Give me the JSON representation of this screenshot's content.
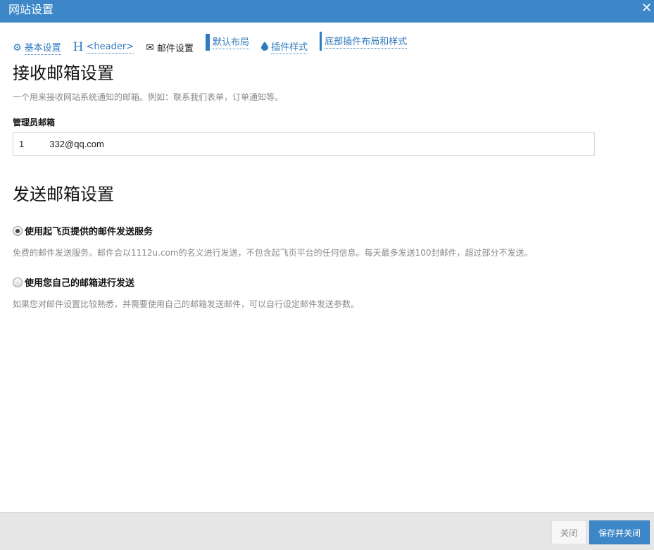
{
  "window": {
    "title": "网站设置",
    "close_label": "✕"
  },
  "tabs": [
    {
      "label": "基本设置",
      "icon": "gear-icon",
      "glyph": "⚙",
      "active": false
    },
    {
      "label": "<header>",
      "icon": "header-h-icon",
      "glyph": "H",
      "active": false
    },
    {
      "label": "邮件设置",
      "icon": "envelope-icon",
      "glyph": "✉",
      "active": true
    },
    {
      "label": "默认布局",
      "icon": "grid-4-icon",
      "active": false
    },
    {
      "label": "插件样式",
      "icon": "droplet-icon",
      "glyph": "💧",
      "active": false
    },
    {
      "label": "底部插件布局和样式",
      "icon": "grid-9-icon",
      "active": false
    }
  ],
  "receive": {
    "heading": "接收邮箱设置",
    "description": "一个用来接收网站系统通知的邮箱。例如：联系我们表单，订单通知等。",
    "field_label": "管理员邮箱",
    "email_value": "1          332@qq.com"
  },
  "send": {
    "heading": "发送邮箱设置",
    "options": [
      {
        "label": "使用起飞页提供的邮件发送服务",
        "description": "免费的邮件发送服务。邮件会以1112u.com的名义进行发送，不包含起飞页平台的任何信息。每天最多发送100封邮件，超过部分不发送。",
        "checked": true
      },
      {
        "label": "使用您自己的邮箱进行发送",
        "description": "如果您对邮件设置比较熟悉，并需要使用自己的邮箱发送邮件，可以自行设定邮件发送参数。",
        "checked": false
      }
    ]
  },
  "footer": {
    "close_label": "关闭",
    "save_label": "保存并关闭"
  },
  "colors": {
    "accent": "#3d87c9",
    "link": "#2f7bbf",
    "footer_bg": "#e6e6e6"
  }
}
